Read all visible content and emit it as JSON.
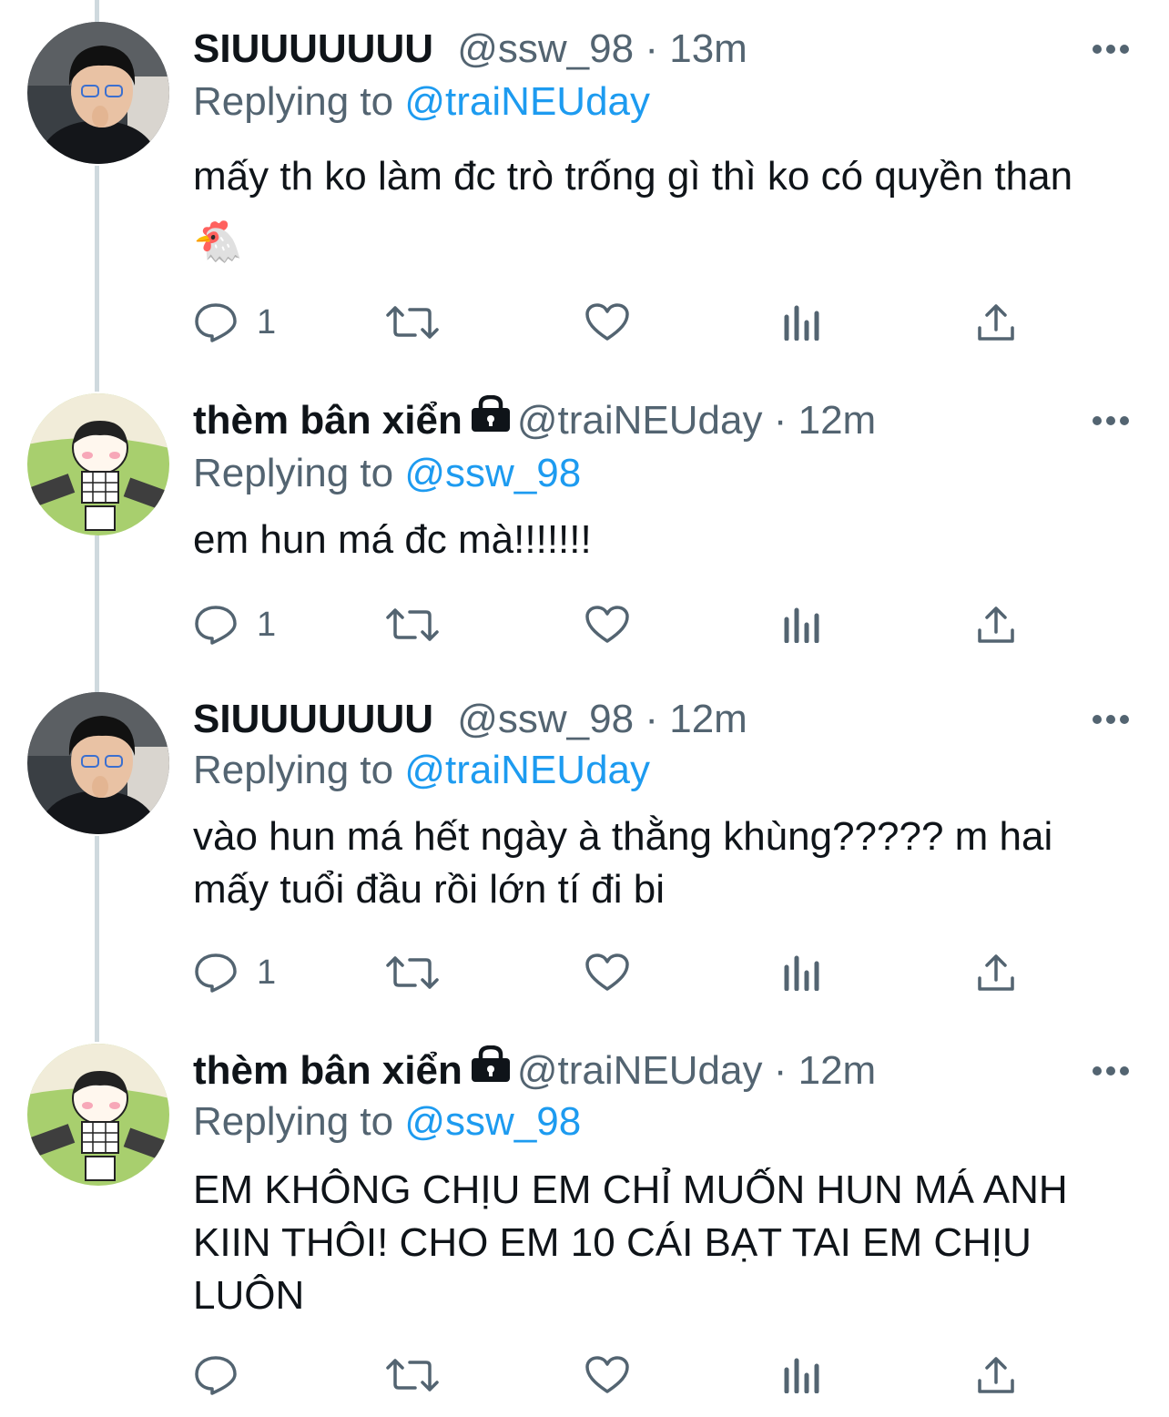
{
  "colors": {
    "text": "#0f1419",
    "secondary": "#536471",
    "accent": "#1d9bf0",
    "thread_line": "#cfd9de"
  },
  "reply_prefix": "Replying to",
  "tweets": [
    {
      "name": "SIUUUUUUU",
      "locked": false,
      "handle": "@ssw_98",
      "separator": "·",
      "time": "13m",
      "replying_to": "@traiNEUday",
      "text": "mấy th ko làm đc trò trống gì thì ko có quyền than 🐔",
      "reply_count": "1",
      "avatar_icon": "man-avatar"
    },
    {
      "name": "thèm bân xiển",
      "locked": true,
      "handle": "@traiNEUday",
      "separator": "·",
      "time": "12m",
      "replying_to": "@ssw_98",
      "text": "em hun má đc mà!!!!!!!",
      "reply_count": "1",
      "avatar_icon": "cartoon-avatar"
    },
    {
      "name": "SIUUUUUUU",
      "locked": false,
      "handle": "@ssw_98",
      "separator": "·",
      "time": "12m",
      "replying_to": "@traiNEUday",
      "text": "vào hun má hết ngày à thằng khùng????? m hai mấy tuổi đầu rồi lớn tí đi bi",
      "reply_count": "1",
      "avatar_icon": "man-avatar"
    },
    {
      "name": "thèm bân xiển",
      "locked": true,
      "handle": "@traiNEUday",
      "separator": "·",
      "time": "12m",
      "replying_to": "@ssw_98",
      "text": "EM KHÔNG CHỊU EM CHỈ MUỐN HUN MÁ ANH KIIN THÔI! CHO EM 10 CÁI BẠT TAI EM CHỊU LUÔN",
      "reply_count": "",
      "avatar_icon": "cartoon-avatar"
    }
  ]
}
